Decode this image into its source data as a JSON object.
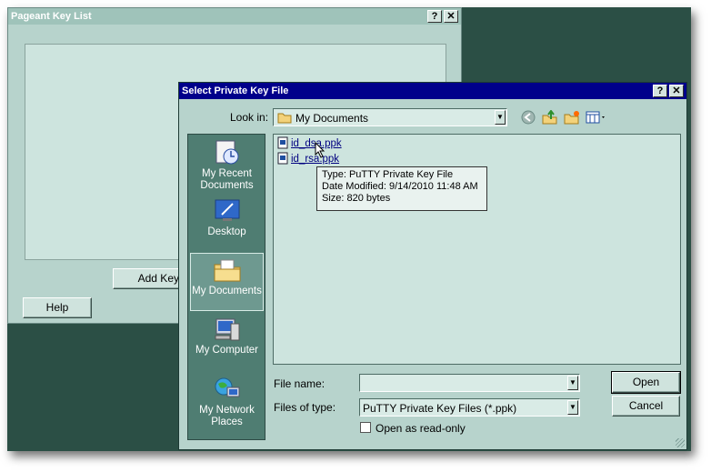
{
  "pageant": {
    "title": "Pageant Key List",
    "help_button": "?",
    "close_button": "✕",
    "add_key_label": "Add Key",
    "help_label": "Help"
  },
  "dialog": {
    "title": "Select Private Key File",
    "help_button": "?",
    "close_button": "✕",
    "look_in_label": "Look in:",
    "look_in_value": "My Documents",
    "places": [
      {
        "label": "My Recent Documents",
        "icon": "recent-documents-icon"
      },
      {
        "label": "Desktop",
        "icon": "desktop-icon"
      },
      {
        "label": "My Documents",
        "icon": "my-documents-icon",
        "selected": true
      },
      {
        "label": "My Computer",
        "icon": "my-computer-icon"
      },
      {
        "label": "My Network Places",
        "icon": "network-places-icon"
      }
    ],
    "files": [
      {
        "name": "id_dsa.ppk"
      },
      {
        "name": "id_rsa.ppk"
      }
    ],
    "tooltip": {
      "type_line": "Type: PuTTY Private Key File",
      "date_line": "Date Modified: 9/14/2010 11:48 AM",
      "size_line": "Size: 820 bytes"
    },
    "file_name_label": "File name:",
    "file_name_value": "",
    "files_of_type_label": "Files of type:",
    "files_of_type_value": "PuTTY Private Key Files (*.ppk)",
    "read_only_label": "Open as read-only",
    "open_label": "Open",
    "cancel_label": "Cancel"
  }
}
